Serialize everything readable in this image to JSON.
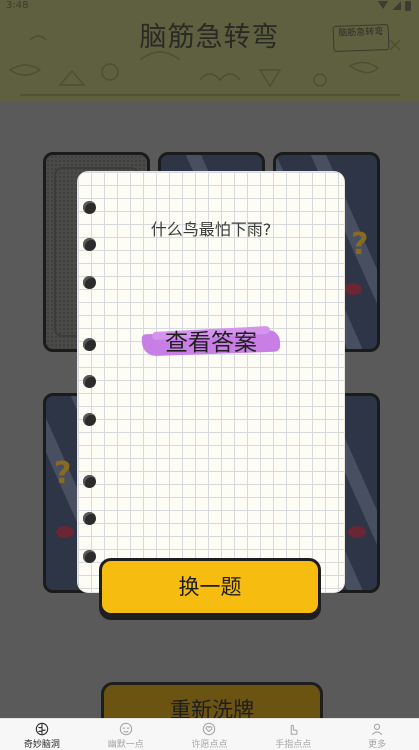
{
  "status_bar": {
    "time": "3:48"
  },
  "header": {
    "title": "脑筋急转弯",
    "badge": "脑筋急转弯"
  },
  "modal": {
    "question": "什么鸟最怕下雨?",
    "answer_button": "查看答案",
    "accent_color": "#c97ee6"
  },
  "change_button": {
    "label": "换一题",
    "color": "#f7bc10"
  },
  "reshuffle_button": {
    "label": "重新洗牌"
  },
  "tabbar": {
    "items": [
      {
        "label": "奇妙脑洞",
        "icon": "brain-icon",
        "active": true
      },
      {
        "label": "幽默一点",
        "icon": "face-icon",
        "active": false
      },
      {
        "label": "许愿点点",
        "icon": "heart-icon",
        "active": false
      },
      {
        "label": "手指点点",
        "icon": "hand-icon",
        "active": false
      },
      {
        "label": "更多",
        "icon": "person-icon",
        "active": false
      }
    ]
  }
}
